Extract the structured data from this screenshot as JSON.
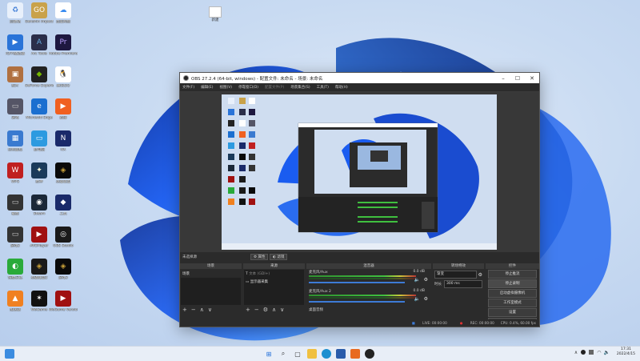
{
  "desktop": {
    "icons": [
      {
        "label": "回收站",
        "color": "#e8f0fb",
        "glyph": "♻",
        "gc": "#3c7bd6"
      },
      {
        "label": "Genshin Impact",
        "color": "#c9a24a",
        "glyph": "GO",
        "gc": "#fff"
      },
      {
        "label": "百度网盘",
        "color": "#ffffff",
        "glyph": "☁",
        "gc": "#3a8cf0"
      },
      {
        "label": "iQIYI播放器",
        "color": "#2a74d8",
        "glyph": "▶",
        "gc": "#fff"
      },
      {
        "label": "Arc Tools",
        "color": "#2a2e4a",
        "glyph": "A",
        "gc": "#6ad"
      },
      {
        "label": "Adobe Premiere",
        "color": "#1e1840",
        "glyph": "Pr",
        "gc": "#b9a0ff"
      },
      {
        "label": "照片",
        "color": "#b07040",
        "glyph": "▣",
        "gc": "#fff"
      },
      {
        "label": "GeForce Experience",
        "color": "#222",
        "glyph": "◆",
        "gc": "#76b900"
      },
      {
        "label": "腾讯QQ",
        "color": "#fff",
        "glyph": "🐧",
        "gc": "#000"
      },
      {
        "label": "游戏",
        "color": "#556",
        "glyph": "▭",
        "gc": "#ccc"
      },
      {
        "label": "Microsoft Edge",
        "color": "#1b6fd0",
        "glyph": "e",
        "gc": "#fff"
      },
      {
        "label": "迅雷",
        "color": "#f06020",
        "glyph": "▶",
        "gc": "#fff"
      },
      {
        "label": "控制面板",
        "color": "#3a7ad0",
        "glyph": "▦",
        "gc": "#fff"
      },
      {
        "label": "此电脑",
        "color": "#2c9ae0",
        "glyph": "▭",
        "gc": "#fff"
      },
      {
        "label": "NX",
        "color": "#1a2a6a",
        "glyph": "N",
        "gc": "#fff"
      },
      {
        "label": "WPS",
        "color": "#c02020",
        "glyph": "W",
        "gc": "#fff"
      },
      {
        "label": "原神",
        "color": "#1a3a5a",
        "glyph": "✦",
        "gc": "#ffd"
      },
      {
        "label": "英雄联盟",
        "color": "#0a0a0a",
        "glyph": "◈",
        "gc": "#caa23a"
      },
      {
        "label": "截图",
        "color": "#333",
        "glyph": "▭",
        "gc": "#ccc"
      },
      {
        "label": "Steam",
        "color": "#1b2838",
        "glyph": "◉",
        "gc": "#fff"
      },
      {
        "label": "工具",
        "color": "#1a2a6a",
        "glyph": "◆",
        "gc": "#fff"
      },
      {
        "label": "游戏2",
        "color": "#333",
        "glyph": "▭",
        "gc": "#ccc"
      },
      {
        "label": "AVEPlayer",
        "color": "#a01010",
        "glyph": "▶",
        "gc": "#fff"
      },
      {
        "label": "OBS Studio",
        "color": "#1a1a1a",
        "glyph": "◎",
        "gc": "#fff"
      },
      {
        "label": "快捷方式",
        "color": "#2aaa3a",
        "glyph": "◐",
        "gc": "#fff"
      },
      {
        "label": "英雄联盟2",
        "color": "#1a1a1a",
        "glyph": "◈",
        "gc": "#caa23a"
      },
      {
        "label": "游戏3",
        "color": "#0a0a0a",
        "glyph": "◈",
        "gc": "#caa23a"
      },
      {
        "label": "加速器",
        "color": "#f08020",
        "glyph": "▲",
        "gc": "#fff"
      },
      {
        "label": "WeGame",
        "color": "#111",
        "glyph": "✶",
        "gc": "#fff"
      },
      {
        "label": "WeGame Version",
        "color": "#a01010",
        "glyph": "▶",
        "gc": "#fff"
      }
    ],
    "top_file_label": "新建"
  },
  "obs": {
    "title": "OBS 27.2.4 (64-bit, windows) - 配置文件: 未命名 - 场景: 未命名",
    "menu": [
      "文件(F)",
      "编辑(E)",
      "视图(V)",
      "停靠窗口(D)",
      "配置文件(P)",
      "场景集合(S)",
      "工具(T)",
      "帮助(H)"
    ],
    "source_label": "未选择源",
    "props_btn": "属性",
    "filters_btn": "滤镜",
    "panels": {
      "scenes": {
        "title": "场景",
        "items": [
          "场景"
        ]
      },
      "sources": {
        "title": "来源",
        "items": [
          "文本 (GDI+)",
          "显示器采集"
        ]
      },
      "mixer": {
        "title": "混音器",
        "tracks": [
          {
            "name": "麦克风/Aux",
            "db": "0.0 dB"
          },
          {
            "name": "麦克风/Aux 2",
            "db": "0.0 dB"
          }
        ],
        "desktop_audio": "桌面音频"
      },
      "transitions": {
        "title": "转场特效",
        "type": "渐变",
        "duration_label": "时长",
        "duration": "300 ms"
      },
      "controls": {
        "title": "控件",
        "buttons": [
          "停止推流",
          "停止录制",
          "启动虚拟摄像机",
          "工作室模式",
          "设置",
          "退出"
        ]
      }
    },
    "status": {
      "live": "LIVE: 00:00:00",
      "rec": "REC: 00:00:00",
      "cpu": "CPU: 0.4%, 60.00 fps"
    }
  },
  "taskbar": {
    "time": "17:31",
    "date": "2022/4/15"
  },
  "colors": {
    "obs_bg": "#2b2b2b",
    "accent": "#3d7bd6",
    "taskbar": "#e8eef7"
  }
}
